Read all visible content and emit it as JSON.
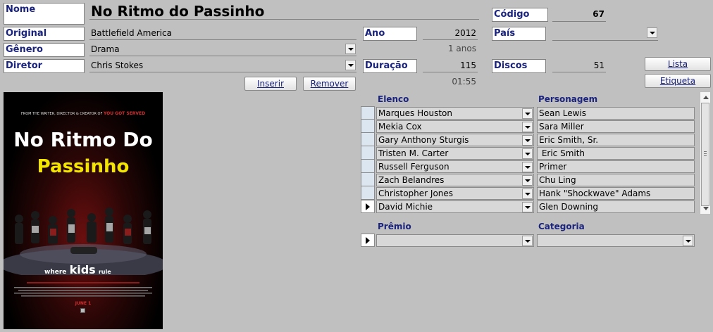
{
  "form": {
    "nome_label": "Nome",
    "nome_value": "No Ritmo do Passinho",
    "codigo_label": "Código",
    "codigo_value": "67",
    "original_label": "Original",
    "original_value": "Battlefield America",
    "ano_label": "Ano",
    "ano_value": "2012",
    "pais_label": "País",
    "pais_value": "",
    "genero_label": "Gênero",
    "genero_value": "Drama",
    "idade_value": "1 anos",
    "diretor_label": "Diretor",
    "diretor_value": "Chris Stokes",
    "duracao_label": "Duração",
    "duracao_value": "115",
    "duracao_time": "01:55",
    "discos_label": "Discos",
    "discos_value": "51"
  },
  "buttons": {
    "inserir": "Inserir",
    "remover": "Remover",
    "lista": "Lista",
    "etiqueta": "Etiqueta"
  },
  "poster": {
    "tagline_top": "FROM THE WRITER, DIRECTOR & CREATOR OF",
    "tagline_brand": "YOU GOT SERVED",
    "title_line1": "No Ritmo Do",
    "title_line2": "Passinho",
    "slogan_where": "where",
    "slogan_kids": "kids",
    "slogan_rule": "rule",
    "release": "JUNE 1",
    "colors": {
      "title2": "#f2e600",
      "brand": "#d32f2f",
      "bg_top": "#000000",
      "bg_glow": "#6b0f0f"
    }
  },
  "cast": {
    "header_elenco": "Elenco",
    "header_personagem": "Personagem",
    "rows": [
      {
        "actor": "Marques Houston",
        "role": "Sean Lewis"
      },
      {
        "actor": "Mekia Cox",
        "role": "Sara Miller"
      },
      {
        "actor": "Gary Anthony Sturgis",
        "role": "Eric Smith, Sr."
      },
      {
        "actor": "Tristen M. Carter",
        "role": " Eric Smith"
      },
      {
        "actor": "Russell Ferguson",
        "role": "Primer"
      },
      {
        "actor": "Zach Belandres",
        "role": "Chu Ling"
      },
      {
        "actor": "Christopher Jones",
        "role": "Hank \"Shockwave\" Adams"
      },
      {
        "actor": "David Michie",
        "role": "Glen Downing"
      }
    ]
  },
  "awards": {
    "header_premio": "Prêmio",
    "header_categoria": "Categoria",
    "premio_value": "",
    "categoria_value": ""
  }
}
